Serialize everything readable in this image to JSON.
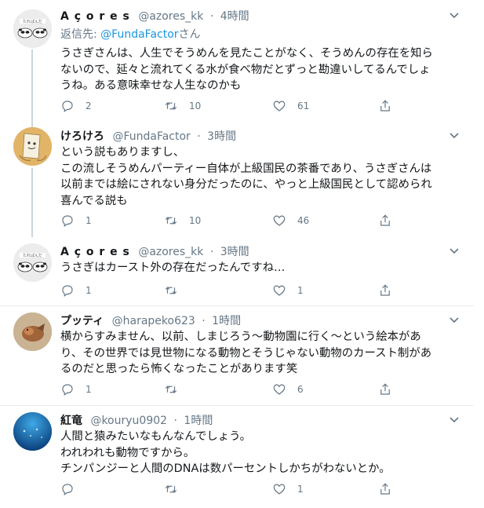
{
  "tweets": [
    {
      "name": "A ç o r e s",
      "handle": "@azores_kk",
      "dot": "·",
      "time": "4時間",
      "reply_label": "返信先:",
      "reply_mention": "@FundaFactor",
      "reply_suffix": "さん",
      "lines": [
        "うさぎさんは、人生でそうめんを見たことがなく、そうめんの存在を知ら",
        "ないので、延々と流れてくる水が食べ物だとずっと勘違いしてるんでしょ",
        "うね。ある意味幸せな人生なのかも"
      ],
      "reply_count": "2",
      "retweet_count": "10",
      "like_count": "61"
    },
    {
      "name": "けろけろ",
      "handle": "@FundaFactor",
      "dot": "·",
      "time": "3時間",
      "lines": [
        "という説もありますし、",
        "この流しそうめんパーティー自体が上級国民の茶番であり、うさぎさんは",
        "以前までは絵にされない身分だったのに、やっと上級国民として認められ",
        "喜んでる説も"
      ],
      "reply_count": "1",
      "retweet_count": "10",
      "like_count": "46"
    },
    {
      "name": "A ç o r e s",
      "handle": "@azores_kk",
      "dot": "·",
      "time": "3時間",
      "lines": [
        "うさぎはカースト外の存在だったんですね…"
      ],
      "reply_count": "1",
      "retweet_count": "",
      "like_count": "1"
    },
    {
      "name": "プッティ",
      "handle": "@harapeko623",
      "dot": "·",
      "time": "1時間",
      "lines": [
        "横からすみません、以前、しまじろう〜動物園に行く〜という絵本があ",
        "り、その世界では見世物になる動物とそうじゃない動物のカースト制があ",
        "るのだと思ったら怖くなったことがあります笑"
      ],
      "reply_count": "1",
      "retweet_count": "",
      "like_count": "6"
    },
    {
      "name": "紅竜",
      "handle": "@kouryu0902",
      "dot": "·",
      "time": "1時間",
      "lines": [
        "人間と猿みたいなもんなんでしょう。",
        "われわれも動物ですから。",
        "チンパンジーと人間のDNAは数パーセントしかちがわないとか。"
      ],
      "reply_count": "",
      "retweet_count": "",
      "like_count": "1"
    }
  ],
  "icons": {
    "reply": "reply-icon",
    "retweet": "retweet-icon",
    "like": "heart-icon",
    "share": "share-icon",
    "caret": "chevron-down-icon"
  },
  "colors": {
    "text": "#14171a",
    "muted": "#657786",
    "link": "#1b95e0",
    "divider": "#e6ecf0",
    "thread": "#ccd6dd"
  }
}
